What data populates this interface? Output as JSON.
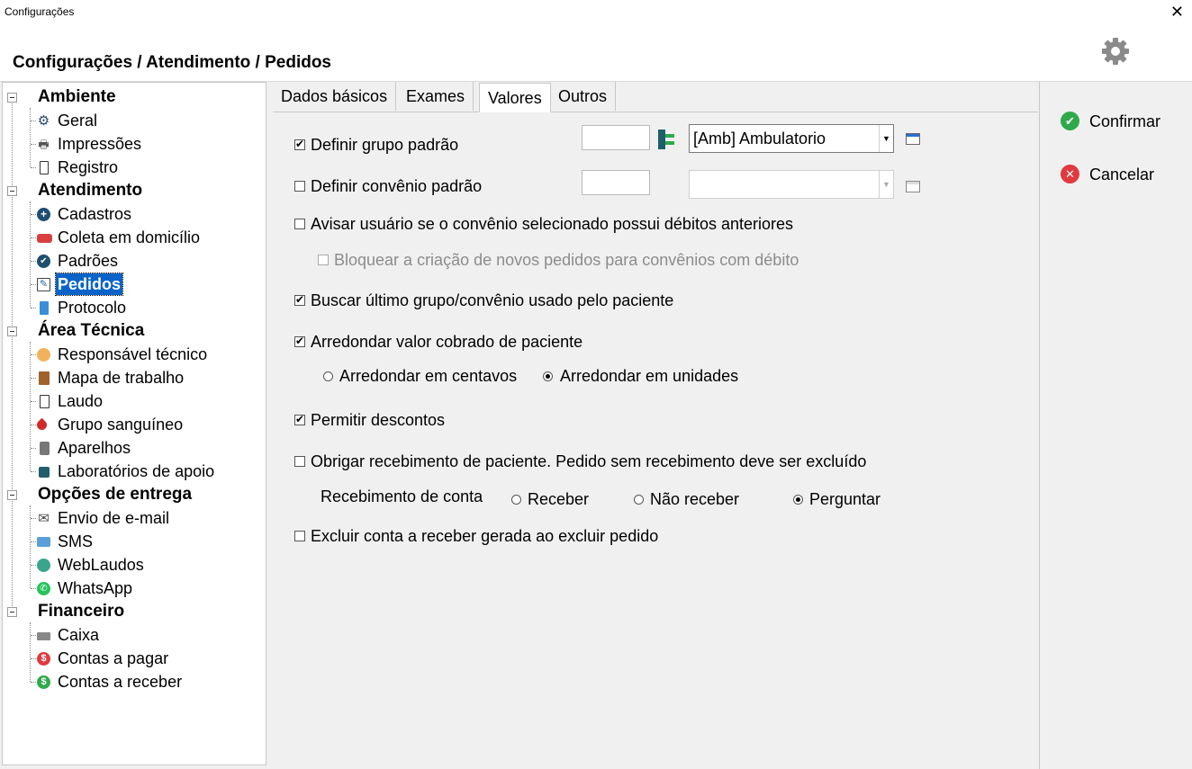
{
  "window": {
    "title": "Configurações",
    "close_glyph": "✕"
  },
  "header": {
    "breadcrumb": "Configurações / Atendimento / Pedidos",
    "icon": "gear-icon"
  },
  "sidebar": {
    "groups": [
      {
        "label": "Ambiente",
        "items": [
          {
            "label": "Geral",
            "icon": "gear-icon"
          },
          {
            "label": "Impressões",
            "icon": "printer-icon"
          },
          {
            "label": "Registro",
            "icon": "document-icon"
          }
        ]
      },
      {
        "label": "Atendimento",
        "items": [
          {
            "label": "Cadastros",
            "icon": "plus-circle-icon"
          },
          {
            "label": "Coleta em domicílio",
            "icon": "ambulance-icon"
          },
          {
            "label": "Padrões",
            "icon": "check-circle-icon"
          },
          {
            "label": "Pedidos",
            "icon": "edit-document-icon",
            "selected": true
          },
          {
            "label": "Protocolo",
            "icon": "notepad-icon"
          }
        ]
      },
      {
        "label": "Área Técnica",
        "items": [
          {
            "label": "Responsável técnico",
            "icon": "person-icon"
          },
          {
            "label": "Mapa de trabalho",
            "icon": "book-icon"
          },
          {
            "label": "Laudo",
            "icon": "report-icon"
          },
          {
            "label": "Grupo sanguíneo",
            "icon": "blood-drop-icon"
          },
          {
            "label": "Aparelhos",
            "icon": "device-icon"
          },
          {
            "label": "Laboratórios de apoio",
            "icon": "microscope-icon"
          }
        ]
      },
      {
        "label": "Opções de entrega",
        "items": [
          {
            "label": "Envio de e-mail",
            "icon": "envelope-icon"
          },
          {
            "label": "SMS",
            "icon": "sms-icon"
          },
          {
            "label": "WebLaudos",
            "icon": "globe-icon"
          },
          {
            "label": "WhatsApp",
            "icon": "whatsapp-icon"
          }
        ]
      },
      {
        "label": "Financeiro",
        "items": [
          {
            "label": "Caixa",
            "icon": "cash-register-icon"
          },
          {
            "label": "Contas a pagar",
            "icon": "dollar-red-icon"
          },
          {
            "label": "Contas a receber",
            "icon": "dollar-green-icon"
          }
        ]
      }
    ]
  },
  "tabs": [
    {
      "label": "Dados básicos"
    },
    {
      "label": "Exames"
    },
    {
      "label": "Valores",
      "active": true
    },
    {
      "label": "Outros"
    }
  ],
  "form": {
    "grupo_padrao": {
      "label": "Definir grupo padrão",
      "checked": true,
      "code_value": "",
      "select_value": "[Amb] Ambulatorio"
    },
    "convenio_padrao": {
      "label": "Definir convênio padrão",
      "checked": false,
      "code_value": "",
      "select_value": ""
    },
    "avisar_debitos": {
      "label": "Avisar usuário se o convênio selecionado possui débitos anteriores",
      "checked": false
    },
    "bloquear_debito": {
      "label": "Bloquear a criação de novos pedidos para convênios com débito",
      "checked": false,
      "disabled": true
    },
    "buscar_ultimo": {
      "label": "Buscar último grupo/convênio usado pelo paciente",
      "checked": true
    },
    "arredondar": {
      "label": "Arredondar valor cobrado de paciente",
      "checked": true,
      "options": [
        {
          "label": "Arredondar em centavos",
          "selected": false
        },
        {
          "label": "Arredondar em unidades",
          "selected": true
        }
      ]
    },
    "descontos": {
      "label": "Permitir descontos",
      "checked": true
    },
    "obrigar_recebimento": {
      "label": "Obrigar recebimento de paciente. Pedido sem recebimento deve ser excluído",
      "checked": false
    },
    "recebimento_conta": {
      "label": "Recebimento de conta",
      "options": [
        {
          "label": "Receber",
          "selected": false
        },
        {
          "label": "Não receber",
          "selected": false
        },
        {
          "label": "Perguntar",
          "selected": true
        }
      ]
    },
    "excluir_conta": {
      "label": "Excluir conta a receber gerada ao excluir pedido",
      "checked": false
    }
  },
  "actions": {
    "confirm": {
      "label": "Confirmar",
      "color": "#2eaa4a"
    },
    "cancel": {
      "label": "Cancelar",
      "color": "#e0393e"
    }
  },
  "colors": {
    "selection": "#0a64c8",
    "accent_blue": "#2a6fd0"
  }
}
